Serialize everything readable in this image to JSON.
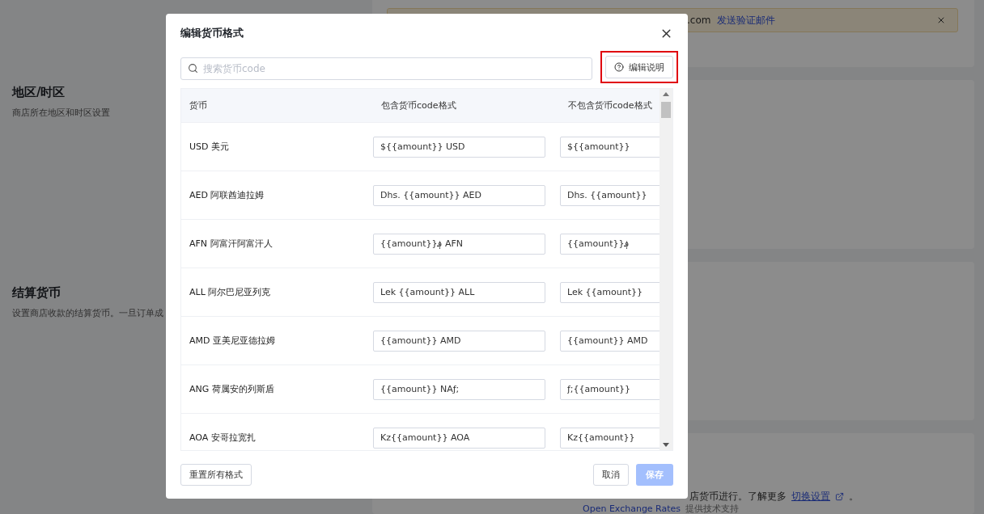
{
  "page": {
    "banner": {
      "text": ".com",
      "link": "发送验证邮件"
    },
    "sections": [
      {
        "title": "地区/时区",
        "description": "商店所在地区和时区设置"
      },
      {
        "title": "结算货币",
        "description": "设置商店收款的结算货币。一旦订单成"
      }
    ],
    "note": {
      "text": "店货币进行。了解更多",
      "link": "切换设置",
      "end": "。",
      "line_2_link": "Open Exchange Rates",
      "line_2_end": "提供技术支持"
    }
  },
  "dialog": {
    "title": "编辑货币格式",
    "search": {
      "placeholder": "搜索货币code"
    },
    "help_button": {
      "label": "编辑说明",
      "highlighted": true
    },
    "table": {
      "columns": [
        "货币",
        "包含货币code格式",
        "不包含货币code格式"
      ],
      "rows": [
        {
          "currency": "USD 美元",
          "with_code": "${{amount}} USD",
          "without_code": "${{amount}}"
        },
        {
          "currency": "AED 阿联酋迪拉姆",
          "with_code": "Dhs. {{amount}} AED",
          "without_code": "Dhs. {{amount}}"
        },
        {
          "currency": "AFN 阿富汗阿富汗人",
          "with_code": "{{amount}}؋ AFN",
          "without_code": "{{amount}}؋"
        },
        {
          "currency": "ALL 阿尔巴尼亚列克",
          "with_code": "Lek {{amount}} ALL",
          "without_code": "Lek {{amount}}"
        },
        {
          "currency": "AMD 亚美尼亚德拉姆",
          "with_code": "{{amount}} AMD",
          "without_code": "{{amount}} AMD"
        },
        {
          "currency": "ANG 荷属安的列斯盾",
          "with_code": "{{amount}} NAƒ;",
          "without_code": "ƒ;{{amount}}"
        },
        {
          "currency": "AOA 安哥拉宽扎",
          "with_code": "Kz{{amount}} AOA",
          "without_code": "Kz{{amount}}"
        }
      ]
    },
    "reset_button": "重置所有格式",
    "cancel_button": "取消",
    "save_button": {
      "label": "保存",
      "disabled": true
    }
  }
}
